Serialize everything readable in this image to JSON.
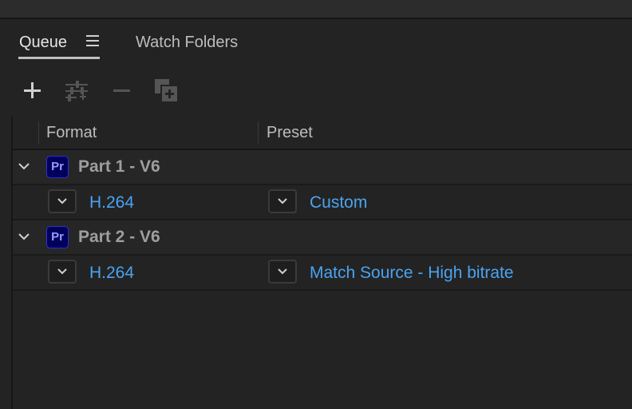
{
  "tabs": {
    "queue_label": "Queue",
    "watch_folders_label": "Watch Folders"
  },
  "toolbar": {
    "icons": [
      "plus-icon",
      "settings-sliders-icon",
      "minus-icon",
      "duplicate-icon"
    ]
  },
  "table": {
    "headers": {
      "format": "Format",
      "preset": "Preset"
    },
    "groups": [
      {
        "badge": "Pr",
        "title": "Part 1 - V6",
        "format": "H.264",
        "preset": "Custom"
      },
      {
        "badge": "Pr",
        "title": "Part 2 - V6",
        "format": "H.264",
        "preset": "Match Source - High bitrate"
      }
    ]
  },
  "colors": {
    "background": "#232323",
    "link": "#4aa3f2",
    "premiere_badge": "#00005b"
  }
}
